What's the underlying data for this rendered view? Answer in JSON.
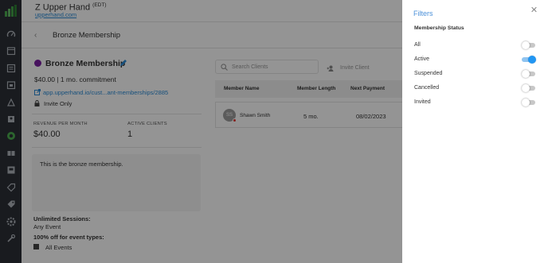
{
  "header": {
    "business_name": "Z Upper Hand",
    "timezone": "(EDT)",
    "business_url": "upperhand.com"
  },
  "subheader": {
    "title": "Bronze Membership"
  },
  "membership": {
    "name": "Bronze Membership",
    "color": "#7b1fa2",
    "price_line": "$40.00  |  1 mo. commitment",
    "link": "app.upperhand.io/cust...ant-memberships/2885",
    "visibility": "Invite Only",
    "revenue_label": "REVENUE PER MONTH",
    "revenue_value": "$40.00",
    "active_label": "ACTIVE CLIENTS",
    "active_value": "1",
    "description": "This is the bronze membership.",
    "sessions_label": "Unlimited Sessions:",
    "sessions_value": "Any Event",
    "discount_label": "100% off for event types:",
    "event_type": "All Events"
  },
  "clients": {
    "search_placeholder": "Search Clients",
    "invite_label": "Invite Client",
    "columns": [
      "Member Name",
      "Member Length",
      "Next Payment"
    ],
    "rows": [
      {
        "initials": "SS",
        "name": "Shawn Smith",
        "length": "5 mo.",
        "next_payment": "08/02/2023"
      }
    ]
  },
  "filters": {
    "title": "Filters",
    "section": "Membership Status",
    "options": [
      {
        "label": "All",
        "enabled": false
      },
      {
        "label": "Active",
        "enabled": true
      },
      {
        "label": "Suspended",
        "enabled": false
      },
      {
        "label": "Cancelled",
        "enabled": false
      },
      {
        "label": "Invited",
        "enabled": false
      }
    ]
  },
  "sidebar": {
    "icons": [
      "logo-icon",
      "dashboard-icon",
      "calendar-icon",
      "reports-icon",
      "events-icon",
      "resources-icon",
      "contacts-icon",
      "memberships-icon",
      "tickets-icon",
      "products-icon",
      "coupons-icon",
      "tags-icon",
      "settings-icon",
      "tools-icon"
    ]
  },
  "colors": {
    "accent": "#2196f3",
    "sidebar": "#2b2f36",
    "link": "#2a8bd6"
  }
}
